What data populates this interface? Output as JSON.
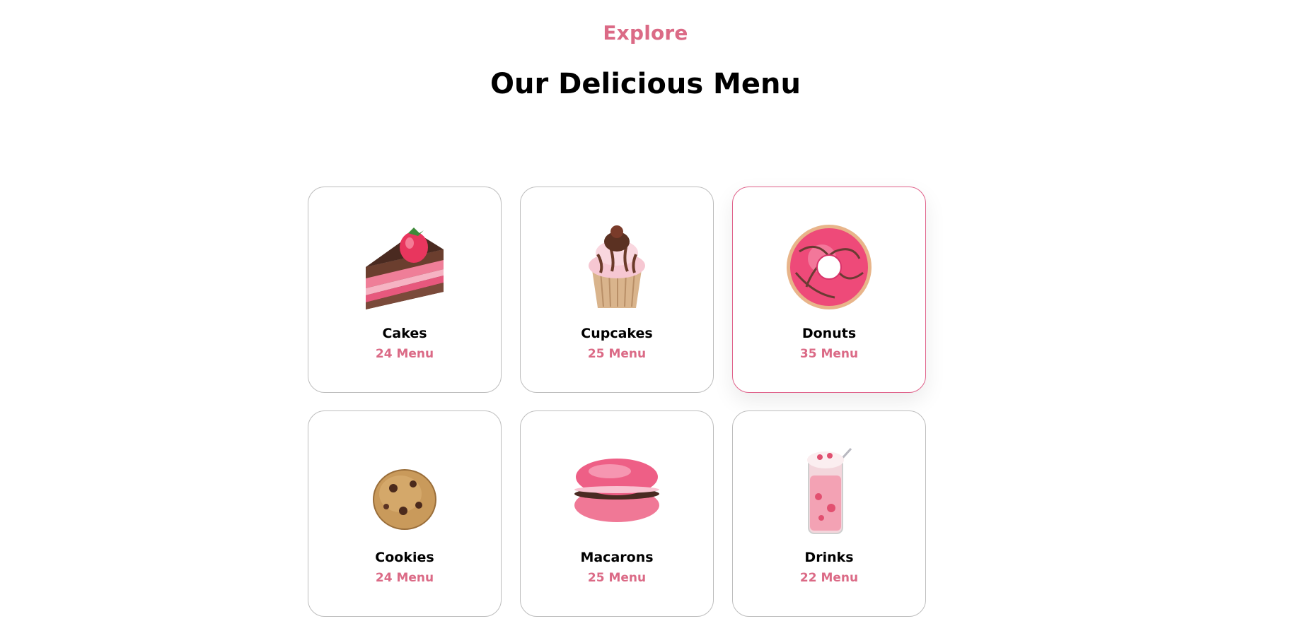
{
  "header": {
    "eyebrow": "Explore",
    "title": "Our Delicious Menu"
  },
  "accent_color": "#db6a86",
  "active_border_color": "#e0618a",
  "categories": [
    {
      "name": "Cakes",
      "count": "24 Menu",
      "icon": "cake-slice-icon"
    },
    {
      "name": "Cupcakes",
      "count": "25 Menu",
      "icon": "cupcake-icon"
    },
    {
      "name": "Donuts",
      "count": "35 Menu",
      "icon": "donut-icon",
      "active": true
    },
    {
      "name": "Cookies",
      "count": "24 Menu",
      "icon": "cookie-icon"
    },
    {
      "name": "Macarons",
      "count": "25 Menu",
      "icon": "macaron-icon"
    },
    {
      "name": "Drinks",
      "count": "22 Menu",
      "icon": "drink-icon"
    }
  ]
}
